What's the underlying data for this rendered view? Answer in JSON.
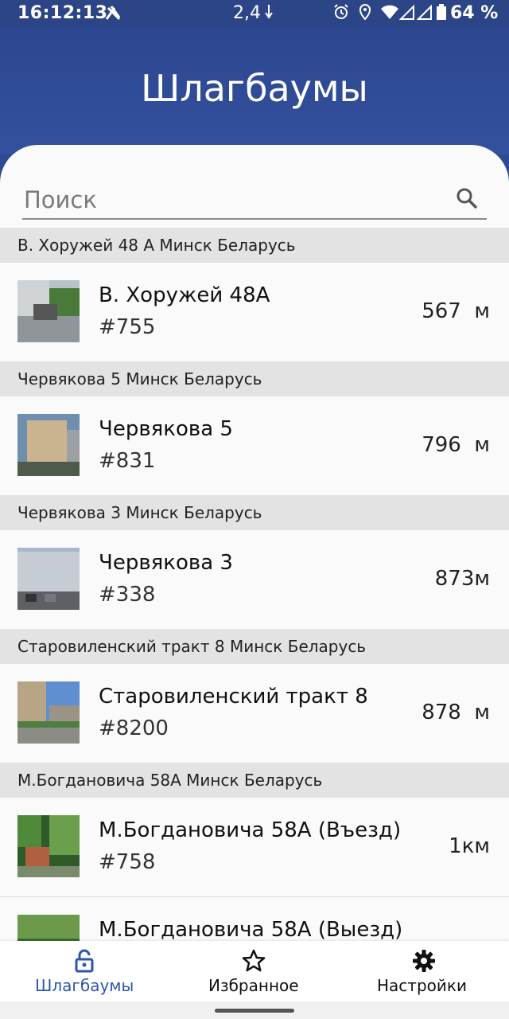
{
  "status_bar": {
    "time": "16:12:13",
    "speed": "2,4",
    "battery": "64 %"
  },
  "header": {
    "title": "Шлагбаумы"
  },
  "search": {
    "placeholder": "Поиск"
  },
  "groups": [
    {
      "address": "В. Хоружей 48 А Минск Беларусь",
      "items": [
        {
          "name": "В. Хоружей 48А",
          "number": "#755",
          "distance": "567  м"
        }
      ]
    },
    {
      "address": "Червякова 5  Минск Беларусь",
      "items": [
        {
          "name": "Червякова 5",
          "number": "#831",
          "distance": "796  м"
        }
      ]
    },
    {
      "address": "Червякова 3  Минск Беларусь",
      "items": [
        {
          "name": "Червякова 3",
          "number": "#338",
          "distance": "873м"
        }
      ]
    },
    {
      "address": "Старовиленский тракт 8  Минск Беларусь",
      "items": [
        {
          "name": "Старовиленский тракт 8",
          "number": "#8200",
          "distance": "878  м"
        }
      ]
    },
    {
      "address": "М.Богдановича 58А  Минск Беларусь",
      "items": [
        {
          "name": "М.Богдановича 58А (Въезд)",
          "number": "#758",
          "distance": "1км"
        },
        {
          "name": "М.Богдановича 58А (Выезд)",
          "number": "",
          "distance": ""
        }
      ]
    }
  ],
  "bottom_nav": {
    "barriers": "Шлагбаумы",
    "favorites": "Избранное",
    "settings": "Настройки",
    "active_color": "#2e56a6"
  },
  "icons": {
    "search": "search-icon",
    "barriers": "lock-icon",
    "favorites": "star-icon",
    "settings": "gear-icon"
  }
}
